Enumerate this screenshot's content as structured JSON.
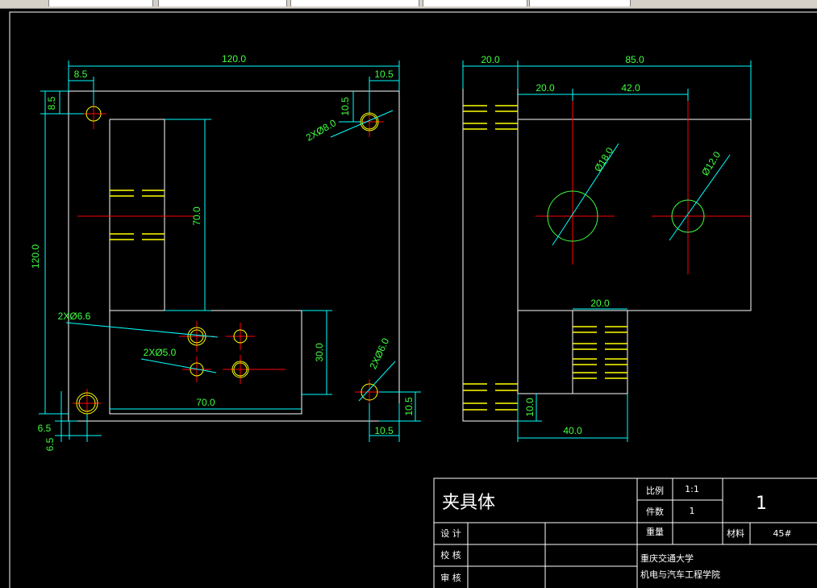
{
  "colors": {
    "outline": "#ffffff",
    "dimension_text": "#40ff40",
    "dimension_line": "#00ffff",
    "center_line": "#ff0000",
    "hole": "#ffff00",
    "hidden_line": "#ffff00"
  },
  "front_view": {
    "dims": {
      "overall_width": "120.0",
      "left_hole_x": "8.5",
      "right_hole_x": "10.5",
      "top_hole_y": "8.5",
      "right_hole_y": "10.5",
      "overall_height": "120.0",
      "slot_height": "70.0",
      "lower_block_height": "30.0",
      "lower_block_width": "70.0",
      "bottom_hole_x": "6.5",
      "bottom_hole_y": "6.5",
      "br_hole_x": "10.5",
      "br_hole_y": "10.5"
    },
    "callouts": {
      "top_right_holes": "2XØ8.0",
      "holes_66": "2XØ6.6",
      "holes_50": "2XØ5.0",
      "holes_60": "2XØ6.0"
    }
  },
  "side_view": {
    "dims": {
      "flange_width": "20.0",
      "body_width": "85.0",
      "hole1_x": "20.0",
      "hole_spacing": "42.0",
      "tab_width": "20.0",
      "tab_height": "10.0",
      "bottom_width": "40.0"
    },
    "callouts": {
      "large_hole": "Ø18.0",
      "small_hole": "Ø12.0"
    }
  },
  "title_block": {
    "part_name": "夹具体",
    "scale_label": "比例",
    "scale_value": "1:1",
    "quantity_label": "件数",
    "quantity_value": "1",
    "weight_label": "重量",
    "material_label": "材料",
    "material_value": "45#",
    "sheet_number": "1",
    "design_label": "设 计",
    "check_label": "校 核",
    "review_label": "审 核",
    "school": "重庆交通大学",
    "college": "机电与汽车工程学院"
  }
}
